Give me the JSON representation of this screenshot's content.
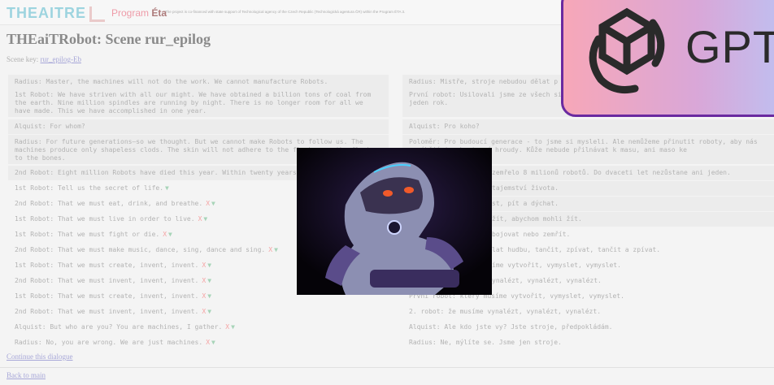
{
  "header": {
    "logo": "THEAITRE",
    "program_prefix": "Program",
    "program_name": "Éta",
    "note": "The project is co-financed with state support of Technological agency of the Czech Republic (Technologická agentura ČR) within the Program ÉTA 3."
  },
  "page": {
    "title": "THEaiTRobot:  Scene rur_epilog",
    "scene_key_label": "Scene key:",
    "scene_key_value": "rur_epilog-Eb",
    "continue_label": "Continue this dialogue",
    "back_label": "Back to main"
  },
  "markers": {
    "delete": "X",
    "generate": "▼"
  },
  "dialogue_en": [
    "Radius: Master, the machines will not do the work. We cannot manufacture Robots.",
    "1st Robot: We have striven with all our might. We have obtained a billion tons of coal from the earth. Nine million spindles are running by night. There is no longer room for all we have made. This we have accomplished in one year.",
    "Alquist: For whom?",
    "Radius: For future generations—so we thought. But we cannot make Robots to follow us. The machines produce only shapeless clods. The skin will not adhere to the flesh, nor the flesh to the bones.",
    "2nd Robot: Eight million Robots have died this year. Within twenty years",
    "1st Robot: Tell us the secret of life.",
    "2nd Robot: That we must eat, drink, and breathe.",
    "1st Robot: That we must live in order to live.",
    "1st Robot: That we must fight or die.",
    "2nd Robot: That we must make music, dance, sing, dance and sing.",
    "1st Robot: That we must create, invent, invent.",
    "2nd Robot: That we must invent, invent, invent.",
    "1st Robot: That we must create, invent, invent.",
    "2nd Robot: That we must invent, invent, invent.",
    "Alquist: But who are you? You are machines, I gather.",
    "Radius: No, you are wrong. We are just machines."
  ],
  "dialogue_cs": [
    "Radius: Mistře, stroje nebudou dělat p",
    "První robot: Usilovali jsme ze všech si milionů vřeten běží ve dne v noci. Už n dosáhli za jeden rok.",
    "Alquist: Pro koho?",
    "Poloměr: Pro budoucí generace - to jsme si mysleli. Ale nemůžeme přinutit roboty, aby nás vyrábějí jen beztvaré hroudy. Kůže nebude přilnávat k masu, ani maso ke",
    "zemřelo 8 milionů robotů. Do dvaceti let nezůstane ani jeden.",
    "tajemství života.",
    "st, pít a dýchat.",
    "žít, abychom mohli žít.",
    "bojovat nebo zemřít.",
    "lat hudbu, tančit, zpívat, tančit a zpívat.",
    "íme vytvořit, vymyslet, vymyslet.",
    "ynalézt, vynalézt, vynalézt.",
    "První robot: který musíme vytvořit, vymyslet, vymyslet.",
    "2. robot: že musíme vynalézt, vynalézt, vynalézt.",
    "Alquist: Ale kdo jste vy? Jste stroje, předpokládám.",
    "Radius: Ne, mýlíte se. Jsme jen stroje."
  ],
  "overlay": {
    "gpt_text": "GPT"
  }
}
